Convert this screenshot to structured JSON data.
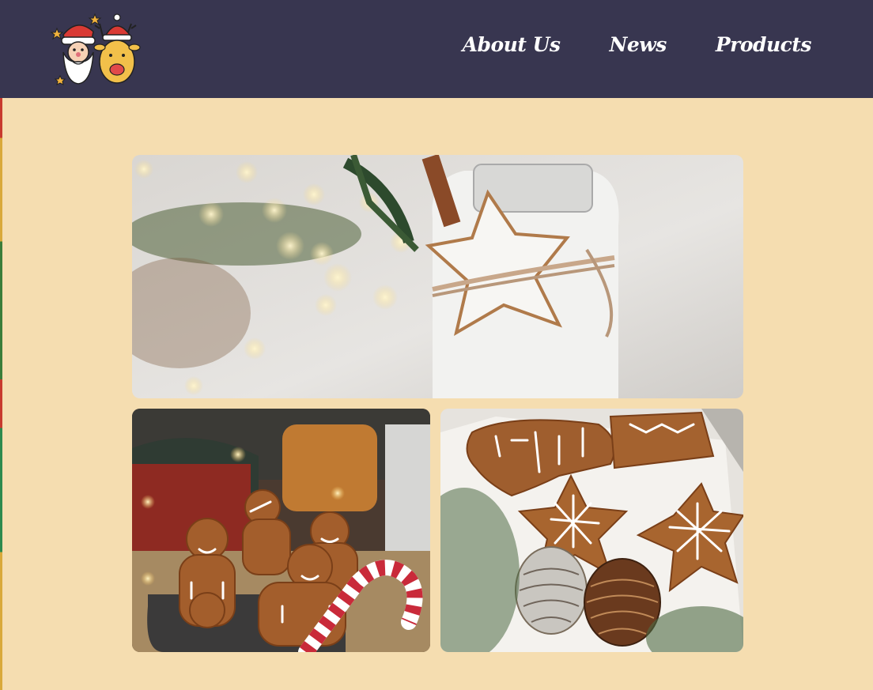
{
  "nav": {
    "items": [
      {
        "label": "About Us"
      },
      {
        "label": "News"
      },
      {
        "label": "Products"
      }
    ]
  },
  "logo": {
    "icon": "santa-and-reindeer-logo-icon"
  },
  "gallery": {
    "images": [
      {
        "icon": "star-cookie-milk-jar-image"
      },
      {
        "icon": "gingerbread-men-mug-image"
      },
      {
        "icon": "star-cookies-pinecones-image"
      }
    ]
  },
  "colors": {
    "header_bg": "#383650",
    "page_bg": "#f5ddb0",
    "nav_text": "#ffffff"
  }
}
